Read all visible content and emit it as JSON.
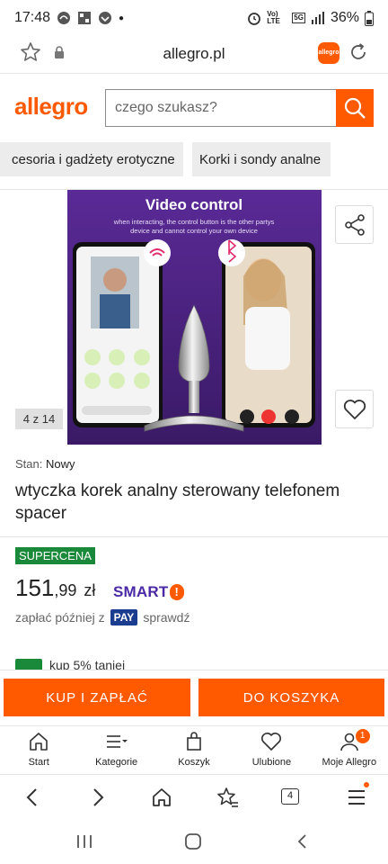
{
  "status_bar": {
    "time": "17:48",
    "network_label": "Vo) LTE",
    "signal_label": "5G",
    "battery": "36%"
  },
  "browser": {
    "url": "allegro.pl",
    "extension_label": "allegro",
    "tab_count": "4"
  },
  "header": {
    "logo": "allegro",
    "search_placeholder": "czego szukasz?"
  },
  "categories": [
    {
      "label": "cesoria i gadżety erotyczne"
    },
    {
      "label": "Korki i sondy analne"
    }
  ],
  "gallery": {
    "counter": "4 z 14",
    "image_heading": "Video control",
    "image_subtitle": "when interacting, the control button is the other partys device and cannot control your own device"
  },
  "product": {
    "condition_label": "Stan:",
    "condition_value": "Nowy",
    "title": "wtyczka korek analny sterowany telefonem spacer",
    "badge": "SUPERCENA",
    "price_int": "151",
    "price_dec": ",99",
    "currency": "zł",
    "smart_label": "SMART",
    "pay_later_prefix": "zapłać później z",
    "pay_label": "PAY",
    "pay_later_suffix": "sprawdź",
    "promo_text": "kup 5% taniej"
  },
  "actions": {
    "buy": "KUP I ZAPŁAĆ",
    "cart": "DO KOSZYKA"
  },
  "app_nav": [
    {
      "label": "Start",
      "icon": "home-icon"
    },
    {
      "label": "Kategorie",
      "icon": "menu-icon"
    },
    {
      "label": "Koszyk",
      "icon": "bag-icon"
    },
    {
      "label": "Ulubione",
      "icon": "heart-icon"
    },
    {
      "label": "Moje Allegro",
      "icon": "user-icon",
      "badge": "1"
    }
  ],
  "colors": {
    "brand": "#ff5a00",
    "supercena": "#1a8a3a",
    "smart": "#4a2aa6",
    "pay": "#1a3d8f"
  }
}
